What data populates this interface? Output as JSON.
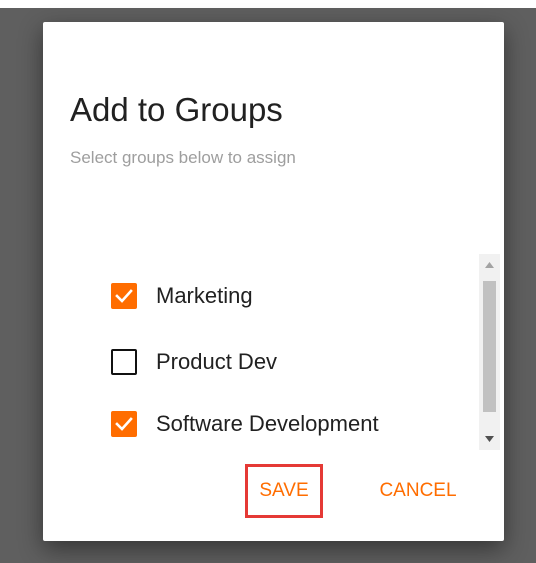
{
  "dialog": {
    "title": "Add to Groups",
    "subtitle": "Select groups below to assign"
  },
  "groups": [
    {
      "label": "Marketing",
      "checked": true
    },
    {
      "label": "Product Dev",
      "checked": false
    },
    {
      "label": "Software Development",
      "checked": true
    }
  ],
  "actions": {
    "save_label": "SAVE",
    "cancel_label": "CANCEL"
  },
  "colors": {
    "accent": "#ff6d00",
    "highlight_border": "#e53935",
    "backdrop": "#5f5f5f"
  },
  "icons": {
    "checked": "check-icon",
    "scroll_up": "scroll-up-arrow-icon",
    "scroll_down": "scroll-down-arrow-icon"
  }
}
